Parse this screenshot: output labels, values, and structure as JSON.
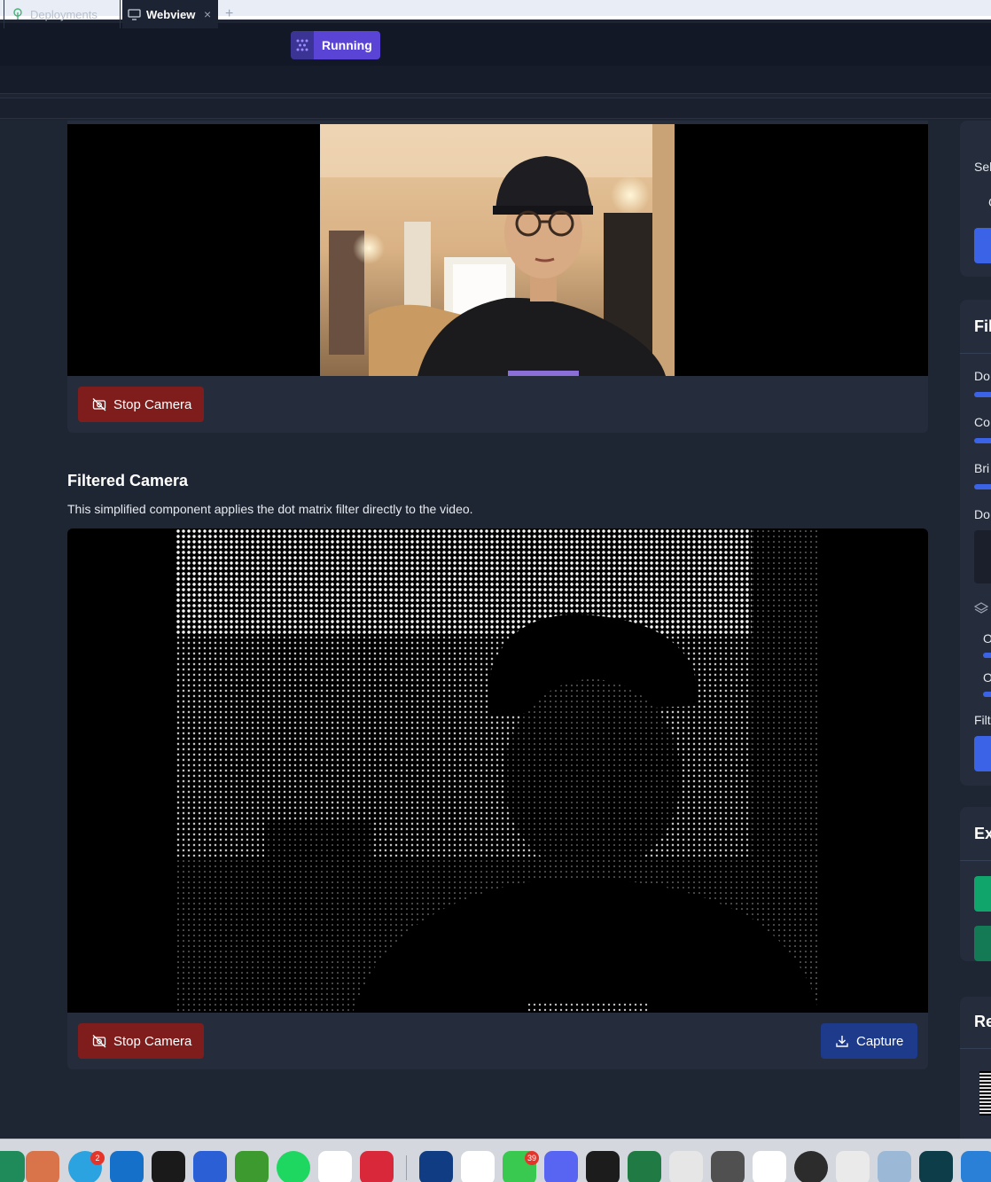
{
  "topbar": {
    "status_label": "Running"
  },
  "tabs": [
    {
      "label": "Deployments",
      "icon": "deployments-tree-icon"
    },
    {
      "label": "Webview",
      "icon": "monitor-icon",
      "close": "×"
    }
  ],
  "tab_add": "+",
  "camera": {
    "stop_label": "Stop Camera"
  },
  "filtered": {
    "title": "Filtered Camera",
    "description": "This simplified component applies the dot matrix filter directly to the video.",
    "stop_label": "Stop Camera",
    "capture_label": "Capture"
  },
  "sidebar": {
    "camera_select": {
      "label": "Sel",
      "option": "C"
    },
    "filters": {
      "title": "Fil",
      "labels": [
        "Do",
        "Co",
        "Bri",
        "Do"
      ],
      "options": [
        "O",
        "O"
      ],
      "filter_label": "Filt"
    },
    "export": {
      "title": "Ex"
    },
    "recent": {
      "title": "Re"
    }
  },
  "dock": {
    "apps": [
      "finder",
      "claude",
      "telegram",
      "outlook",
      "activity-monitor",
      "vscode",
      "minecraft",
      "spotify",
      "capcut",
      "expressvpn",
      "readwise",
      "spark",
      "messages",
      "discord",
      "cube",
      "excel",
      "installer",
      "microsoft",
      "calculator",
      "wps",
      "quicktime",
      "xcode",
      "preview",
      "perplexity"
    ],
    "telegram_badge": "2",
    "messages_badge": "39"
  },
  "colors": {
    "accent": "#3b63e8",
    "running": "#5a44d6",
    "stop": "#7f1d1d",
    "capture": "#1e3a8a",
    "background": "#1f2633"
  }
}
